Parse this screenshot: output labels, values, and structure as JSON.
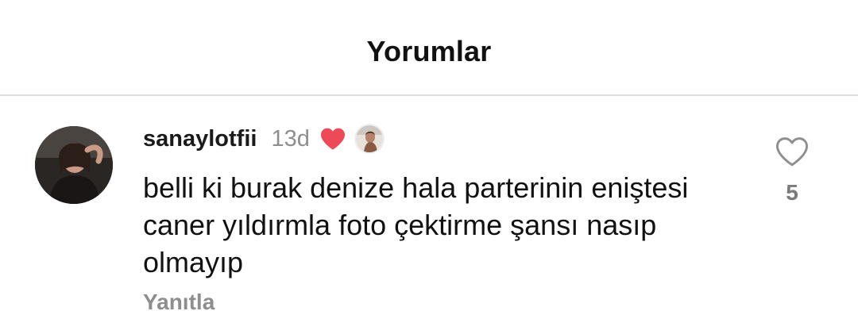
{
  "header": {
    "title": "Yorumlar"
  },
  "comment": {
    "username": "sanaylotfii",
    "timestamp": "13d",
    "liked_by_author_icon": "heart-filled-icon",
    "text": "belli ki burak denize hala parterinin eniştesi caner yıldırmla foto çektirme şansı nasıp olmayıp",
    "reply_label": "Yanıtla",
    "like_count": "5",
    "like_icon": "heart-outline-icon"
  },
  "colors": {
    "heart_red": "#ed4956",
    "muted_text": "#8e8e8e",
    "divider": "#dcdcdc"
  }
}
